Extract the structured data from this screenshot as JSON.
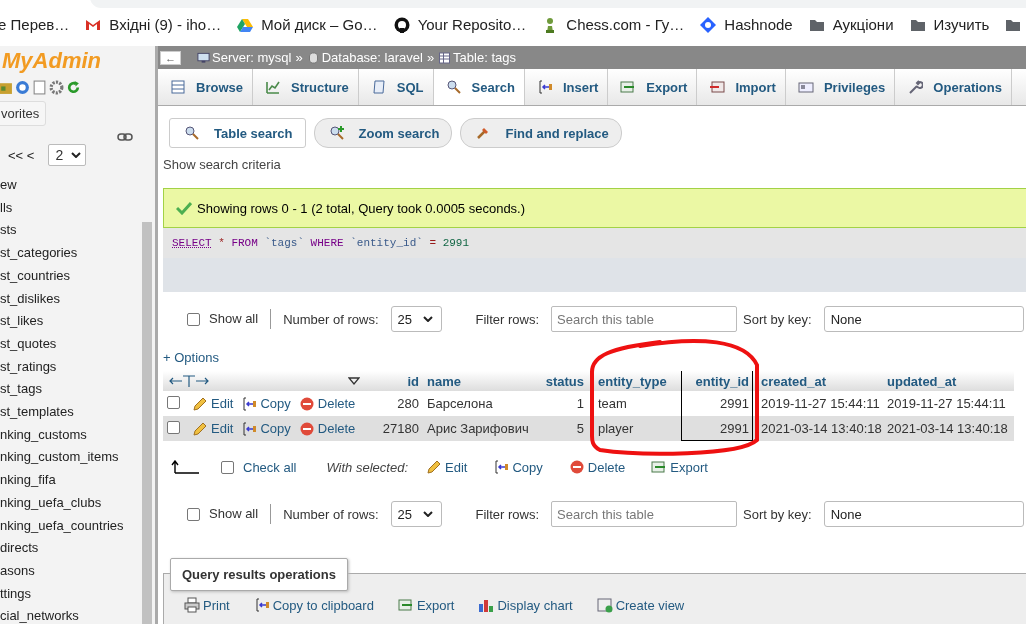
{
  "browser": {
    "bookmarks": [
      {
        "kind": "plain",
        "label": "е Перев…"
      },
      {
        "kind": "mail",
        "label": "Вхідні (9) - iho…"
      },
      {
        "kind": "drive",
        "label": "Мой диск – Go…"
      },
      {
        "kind": "github",
        "label": "Your Reposito…"
      },
      {
        "kind": "chess",
        "label": "Chess.com - Гу…"
      },
      {
        "kind": "diamond",
        "label": "Hashnode"
      },
      {
        "kind": "folder",
        "label": "Аукціони"
      },
      {
        "kind": "folder",
        "label": "Изучить"
      }
    ]
  },
  "sidebar": {
    "logo": "MyAdmin",
    "favorites_button": "vorites",
    "pager": {
      "prev": "<< <",
      "page": "2"
    },
    "tables": [
      "ew",
      "lls",
      "sts",
      "st_categories",
      "st_countries",
      "st_dislikes",
      "st_likes",
      "st_quotes",
      "st_ratings",
      "st_tags",
      "st_templates",
      "nking_customs",
      "nking_custom_items",
      "nking_fifa",
      "nking_uefa_clubs",
      "nking_uefa_countries",
      "directs",
      "asons",
      "ttings",
      "cial_networks"
    ]
  },
  "collapse_button": "←",
  "breadcrumb": [
    {
      "kind": "server",
      "label": "Server: mysql"
    },
    {
      "kind": "database",
      "label": "Database: laravel"
    },
    {
      "kind": "table",
      "label": "Table: tags"
    }
  ],
  "breadcrumb_separator": "»",
  "tabs": [
    {
      "kind": "browse",
      "label": "Browse",
      "selected": false
    },
    {
      "kind": "structure",
      "label": "Structure",
      "selected": false
    },
    {
      "kind": "sql",
      "label": "SQL",
      "selected": false
    },
    {
      "kind": "search",
      "label": "Search",
      "selected": true
    },
    {
      "kind": "insert",
      "label": "Insert",
      "selected": false
    },
    {
      "kind": "export",
      "label": "Export",
      "selected": false
    },
    {
      "kind": "import",
      "label": "Import",
      "selected": false
    },
    {
      "kind": "privileges",
      "label": "Privileges",
      "selected": false
    },
    {
      "kind": "operations",
      "label": "Operations",
      "selected": false
    }
  ],
  "search_modes": [
    {
      "kind": "search",
      "label": "Table search",
      "selected": true
    },
    {
      "kind": "zoom",
      "label": "Zoom search",
      "selected": false
    },
    {
      "kind": "replace",
      "label": "Find and replace",
      "selected": false
    }
  ],
  "show_criteria": "Show search criteria",
  "message": "Showing rows 0 - 1 (2 total, Query took 0.0005 seconds.)",
  "sql": [
    {
      "kind": "keyword",
      "text": "SELECT",
      "link": true
    },
    {
      "kind": "operator",
      "text": "*"
    },
    {
      "kind": "keyword",
      "text": "FROM"
    },
    {
      "kind": "identifier",
      "text": "`tags`"
    },
    {
      "kind": "keyword",
      "text": "WHERE"
    },
    {
      "kind": "identifier",
      "text": "`entity_id`"
    },
    {
      "kind": "operator",
      "text": "="
    },
    {
      "kind": "number",
      "text": "2991"
    }
  ],
  "controls": [
    {
      "show_all": {
        "label": "Show all",
        "checked": false
      },
      "rows_label": "Number of rows:",
      "rows_value": "25",
      "filter_label": "Filter rows:",
      "filter_placeholder": "Search this table",
      "sort_label": "Sort by key:",
      "sort_value": "None"
    },
    {
      "show_all": {
        "label": "Show all",
        "checked": false
      },
      "rows_label": "Number of rows:",
      "rows_value": "25",
      "filter_label": "Filter rows:",
      "filter_placeholder": "Search this table",
      "sort_label": "Sort by key:",
      "sort_value": "None"
    }
  ],
  "options_link": "+ Options",
  "table": {
    "columns": [
      {
        "label": "id",
        "marked": false
      },
      {
        "label": "name",
        "marked": false
      },
      {
        "label": "status",
        "marked": false
      },
      {
        "label": "entity_type",
        "marked": false
      },
      {
        "label": "entity_id",
        "marked": true
      },
      {
        "label": "created_at",
        "marked": false
      },
      {
        "label": "updated_at",
        "marked": false
      }
    ],
    "rows": [
      {
        "checked": false,
        "actions": [
          {
            "kind": "edit",
            "label": "Edit"
          },
          {
            "kind": "copy",
            "label": "Copy"
          },
          {
            "kind": "delete",
            "label": "Delete"
          }
        ],
        "cells": [
          "280",
          "Барселона",
          "1",
          "team",
          "2991",
          "2019-11-27 15:44:11",
          "2019-11-27 15:44:11"
        ]
      },
      {
        "checked": false,
        "actions": [
          {
            "kind": "edit",
            "label": "Edit"
          },
          {
            "kind": "copy",
            "label": "Copy"
          },
          {
            "kind": "delete",
            "label": "Delete"
          }
        ],
        "cells": [
          "27180",
          "Арис Зарифович",
          "5",
          "player",
          "2991",
          "2021-03-14 13:40:18",
          "2021-03-14 13:40:18"
        ]
      }
    ]
  },
  "bulk": {
    "check_all": {
      "label": "Check all",
      "checked": false
    },
    "with_selected": "With selected:",
    "actions": [
      {
        "kind": "edit",
        "label": "Edit"
      },
      {
        "kind": "copy",
        "label": "Copy"
      },
      {
        "kind": "delete",
        "label": "Delete"
      },
      {
        "kind": "export",
        "label": "Export"
      }
    ]
  },
  "query_ops": {
    "legend": "Query results operations",
    "actions": [
      {
        "kind": "print",
        "label": "Print"
      },
      {
        "kind": "copy",
        "label": "Copy to clipboard"
      },
      {
        "kind": "export",
        "label": "Export"
      },
      {
        "kind": "chart",
        "label": "Display chart"
      },
      {
        "kind": "view",
        "label": "Create view"
      }
    ]
  }
}
